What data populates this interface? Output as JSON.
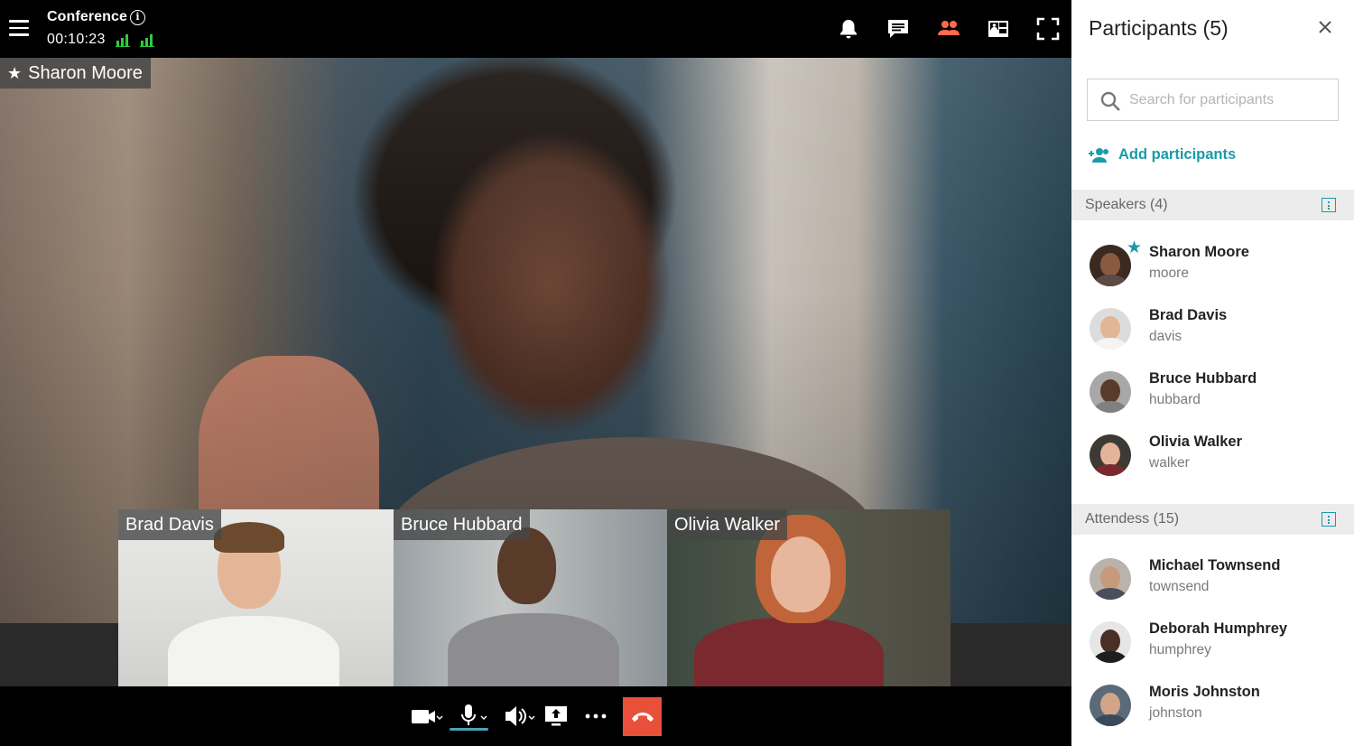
{
  "header": {
    "title": "Conference",
    "timer": "00:10:23"
  },
  "main_speaker": {
    "name": "Sharon Moore"
  },
  "thumbnails": [
    {
      "name": "Brad Davis"
    },
    {
      "name": "Bruce Hubbard"
    },
    {
      "name": "Olivia Walker"
    }
  ],
  "toolbar_icons": [
    "bell-icon",
    "chat-icon",
    "participants-icon",
    "layout-icon",
    "fullscreen-icon"
  ],
  "controls": [
    "camera",
    "microphone",
    "speaker",
    "screen-share",
    "more",
    "hang-up"
  ],
  "colors": {
    "accent": "#1b9aaa",
    "participants_active": "#ff6a4d",
    "hangup": "#e8503a",
    "signal": "#2ecc40"
  },
  "sidebar": {
    "title": "Participants (5)",
    "search_placeholder": "Search for participants",
    "add_label": "Add participants",
    "speakers": {
      "label": "Speakers (4)",
      "items": [
        {
          "name": "Sharon Moore",
          "username": "moore"
        },
        {
          "name": "Brad Davis",
          "username": "davis"
        },
        {
          "name": "Bruce Hubbard",
          "username": "hubbard"
        },
        {
          "name": "Olivia Walker",
          "username": "walker"
        }
      ]
    },
    "attendees": {
      "label": "Attendess (15)",
      "items": [
        {
          "name": "Michael Townsend",
          "username": "townsend"
        },
        {
          "name": "Deborah Humphrey",
          "username": "humphrey"
        },
        {
          "name": "Moris Johnston",
          "username": "johnston"
        }
      ]
    }
  }
}
